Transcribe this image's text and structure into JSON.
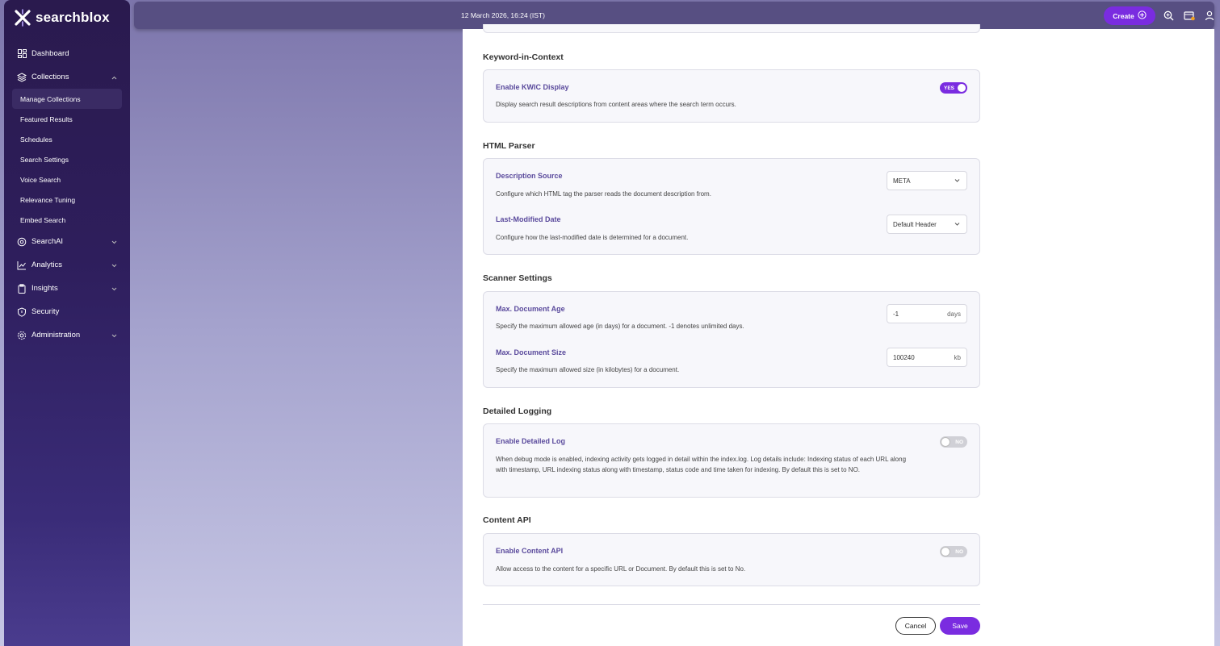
{
  "app": {
    "logo_text": "searchblox"
  },
  "topbar": {
    "datetime": "12 March 2026, 16:24 (IST)",
    "create_label": "Create"
  },
  "sidebar": {
    "items": [
      {
        "label": "Dashboard",
        "icon": "dashboard-icon"
      },
      {
        "label": "Collections",
        "icon": "layers-icon",
        "expanded": true
      },
      {
        "label": "SearchAI",
        "icon": "globe-icon"
      },
      {
        "label": "Analytics",
        "icon": "chart-icon"
      },
      {
        "label": "Insights",
        "icon": "clipboard-icon"
      },
      {
        "label": "Security",
        "icon": "shield-icon"
      },
      {
        "label": "Administration",
        "icon": "gear-icon"
      }
    ],
    "collections_sub": [
      {
        "label": "Manage Collections",
        "active": true
      },
      {
        "label": "Featured Results"
      },
      {
        "label": "Schedules"
      },
      {
        "label": "Search Settings"
      },
      {
        "label": "Voice Search"
      },
      {
        "label": "Relevance Tuning"
      },
      {
        "label": "Embed Search"
      }
    ]
  },
  "sections": {
    "kwic": {
      "title": "Keyword-in-Context",
      "label": "Enable KWIC Display",
      "desc": "Display search result descriptions from content areas where the search term occurs.",
      "toggle": "YES"
    },
    "html_parser": {
      "title": "HTML Parser",
      "desc_source_label": "Description Source",
      "desc_source_desc": "Configure which HTML tag the parser reads the document description from.",
      "desc_source_value": "META",
      "lastmod_label": "Last-Modified Date",
      "lastmod_desc": "Configure how the last-modified date is determined for a document.",
      "lastmod_value": "Default Header"
    },
    "scanner": {
      "title": "Scanner Settings",
      "age_label": "Max. Document Age",
      "age_desc": "Specify the maximum allowed age (in days) for a document. -1 denotes unlimited days.",
      "age_value": "-1",
      "age_unit": "days",
      "size_label": "Max. Document Size",
      "size_desc": "Specify the maximum allowed size (in kilobytes) for a document.",
      "size_value": "100240",
      "size_unit": "kb"
    },
    "logging": {
      "title": "Detailed Logging",
      "label": "Enable Detailed Log",
      "desc": "When debug mode is enabled, indexing activity gets logged in detail within the index.log. Log details include: Indexing status of each URL along with timestamp, URL indexing status along with timestamp, status code and time taken for indexing. By default this is set to NO.",
      "toggle": "NO"
    },
    "content_api": {
      "title": "Content API",
      "label": "Enable Content API",
      "desc": "Allow access to the content for a specific URL or Document. By default this is set to No.",
      "toggle": "NO"
    }
  },
  "footer": {
    "cancel_label": "Cancel",
    "save_label": "Save"
  },
  "colors": {
    "accent": "#7a2ce0",
    "label": "#5a4a9c",
    "sidebar": "#2a1a4e"
  }
}
